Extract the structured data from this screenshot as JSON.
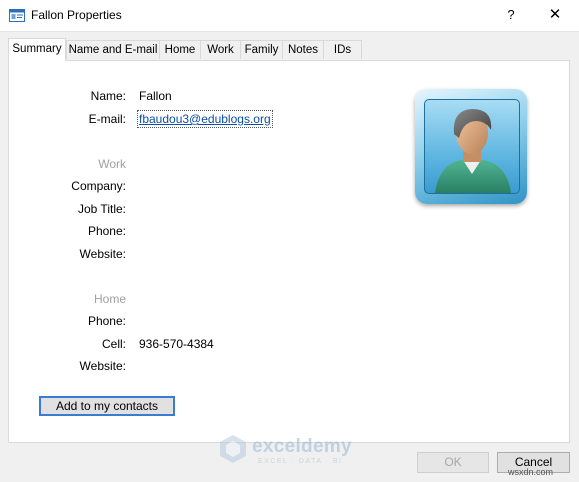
{
  "window": {
    "title": "Fallon Properties",
    "help_glyph": "?",
    "close_glyph": "✕"
  },
  "tabs": [
    {
      "label": "Summary",
      "active": true
    },
    {
      "label": "Name and E-mail",
      "active": false
    },
    {
      "label": "Home",
      "active": false
    },
    {
      "label": "Work",
      "active": false
    },
    {
      "label": "Family",
      "active": false
    },
    {
      "label": "Notes",
      "active": false
    },
    {
      "label": "IDs",
      "active": false
    }
  ],
  "summary": {
    "name_label": "Name:",
    "name_value": "Fallon",
    "email_label": "E-mail:",
    "email_value": "fbaudou3@edublogs.org",
    "work_section": "Work",
    "company_label": "Company:",
    "job_title_label": "Job Title:",
    "work_phone_label": "Phone:",
    "work_website_label": "Website:",
    "home_section": "Home",
    "home_phone_label": "Phone:",
    "cell_label": "Cell:",
    "cell_value": "936-570-4384",
    "home_website_label": "Website:",
    "add_button": "Add to my contacts"
  },
  "footer": {
    "ok_label": "OK",
    "cancel_label": "Cancel"
  },
  "watermark": {
    "brand": "exceldemy",
    "tagline": "EXCEL · DATA · BI",
    "site": "wsxdn.com"
  },
  "colors": {
    "link": "#0b4fa6",
    "section_gray": "#a0a0a0",
    "focus_border": "#3c7bd1"
  }
}
